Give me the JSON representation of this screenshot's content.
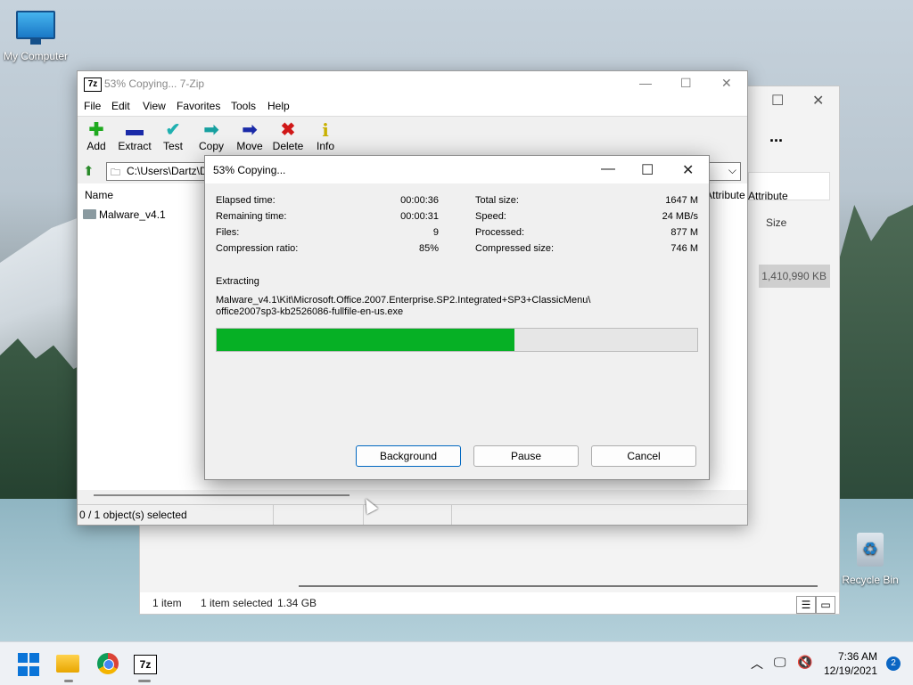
{
  "desktop": {
    "my_computer_label": "My Computer",
    "recycle_bin_label": "Recycle Bin"
  },
  "explorer_back": {
    "more_label": "...",
    "col_attributes": "Attribute",
    "col_size": "Size",
    "file_size": "1,410,990 KB",
    "status_items": "1 item",
    "status_selected": "1 item selected",
    "status_size": "1.34 GB"
  },
  "zip_window": {
    "title": "53% Copying... 7-Zip",
    "app_icon_text": "7z",
    "menu": [
      "File",
      "Edit",
      "View",
      "Favorites",
      "Tools",
      "Help"
    ],
    "toolbar": [
      {
        "label": "Add",
        "icon": "plus-icon",
        "color": "#1faa1f",
        "glyph": "✚"
      },
      {
        "label": "Extract",
        "icon": "minus-icon",
        "color": "#1a2aa8",
        "glyph": "▬"
      },
      {
        "label": "Test",
        "icon": "check-icon",
        "color": "#1fb0b0",
        "glyph": "✔"
      },
      {
        "label": "Copy",
        "icon": "copy-arrow-icon",
        "color": "#16a0a0",
        "glyph": "➡"
      },
      {
        "label": "Move",
        "icon": "move-arrow-icon",
        "color": "#1a2aa8",
        "glyph": "➡"
      },
      {
        "label": "Delete",
        "icon": "delete-x-icon",
        "color": "#d01818",
        "glyph": "✖"
      },
      {
        "label": "Info",
        "icon": "info-icon",
        "color": "#c8b000",
        "glyph": "i"
      }
    ],
    "address": "C:\\Users\\Dartz\\D",
    "col_name": "Name",
    "col_attributes": "Attribute",
    "files": [
      {
        "name": "Malware_v4.1",
        "type": "folder"
      }
    ],
    "status_text": "0 / 1 object(s) selected"
  },
  "progress_dialog": {
    "title": "53% Copying...",
    "left_stats": [
      {
        "label": "Elapsed time:",
        "value": "00:00:36"
      },
      {
        "label": "Remaining time:",
        "value": "00:00:31"
      },
      {
        "label": "Files:",
        "value": "9"
      },
      {
        "label": "Compression ratio:",
        "value": "85%"
      }
    ],
    "right_stats": [
      {
        "label": "Total size:",
        "value": "1647 M"
      },
      {
        "label": "Speed:",
        "value": "24 MB/s"
      },
      {
        "label": "Processed:",
        "value": "877 M"
      },
      {
        "label": "Compressed size:",
        "value": "746 M"
      }
    ],
    "operation": "Extracting",
    "path_line1": "Malware_v4.1\\Kit\\Microsoft.Office.2007.Enterprise.SP2.Integrated+SP3+ClassicMenu\\",
    "path_line2": "office2007sp3-kb2526086-fullfile-en-us.exe",
    "progress_fraction": 0.62,
    "progress_color": "#06b025",
    "buttons": {
      "background": "Background",
      "pause": "Pause",
      "cancel": "Cancel"
    }
  },
  "taskbar": {
    "time": "7:36 AM",
    "date": "12/19/2021",
    "notification_count": "2",
    "zip_icon_text": "7z"
  }
}
